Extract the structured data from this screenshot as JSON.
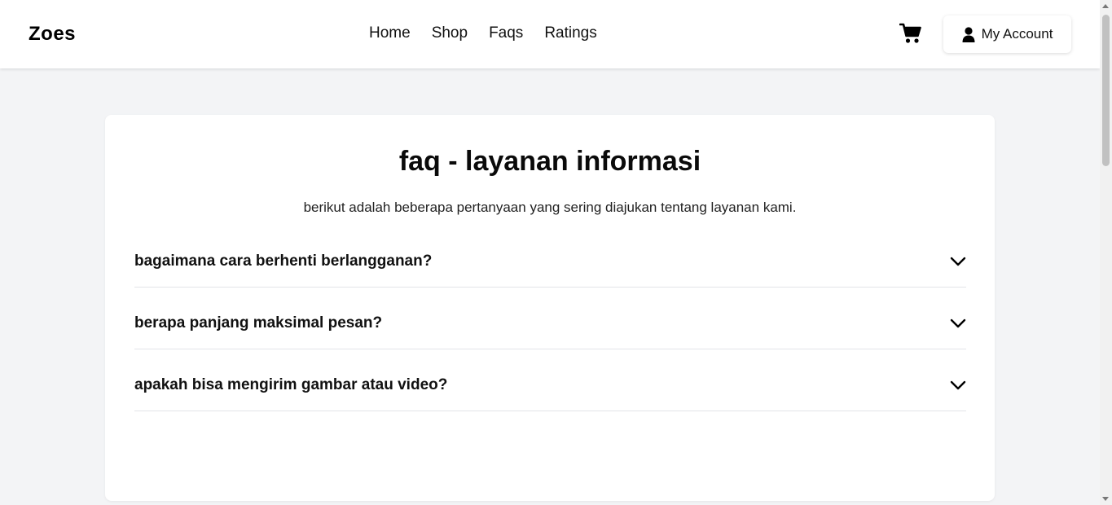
{
  "brand": {
    "name": "Zoes"
  },
  "nav": {
    "links": [
      {
        "label": "Home"
      },
      {
        "label": "Shop"
      },
      {
        "label": "Faqs"
      },
      {
        "label": "Ratings"
      }
    ],
    "cart_icon": "cart-icon",
    "account": {
      "label": "My Account",
      "icon": "user-icon"
    }
  },
  "faq": {
    "title": "faq - layanan informasi",
    "subtitle": "berikut adalah beberapa pertanyaan yang sering diajukan tentang layanan kami.",
    "items": [
      {
        "question": "bagaimana cara berhenti berlangganan?",
        "icon": "chevron-down-icon"
      },
      {
        "question": "berapa panjang maksimal pesan?",
        "icon": "chevron-down-icon"
      },
      {
        "question": "apakah bisa mengirim gambar atau video?",
        "icon": "chevron-down-icon"
      }
    ]
  },
  "colors": {
    "page_background": "#f3f4f6",
    "card_background": "#ffffff",
    "divider": "#e2e4e8",
    "text": "#111111"
  }
}
